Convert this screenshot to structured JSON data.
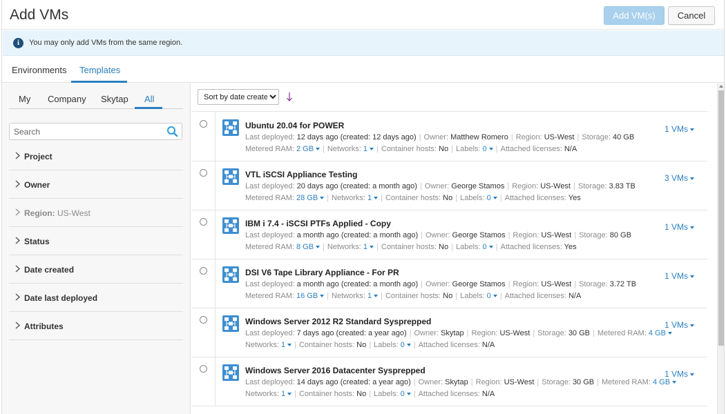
{
  "header": {
    "title": "Add VMs",
    "add_label": "Add VM(s)",
    "cancel_label": "Cancel"
  },
  "info": {
    "text": "You may only add VMs from the same region."
  },
  "tabs": [
    {
      "label": "Environments"
    },
    {
      "label": "Templates",
      "active": true
    }
  ],
  "sidebar": {
    "subtabs": [
      {
        "label": "My"
      },
      {
        "label": "Company"
      },
      {
        "label": "Skytap"
      },
      {
        "label": "All",
        "active": true
      }
    ],
    "search_placeholder": "Search",
    "filters": [
      {
        "label": "Project"
      },
      {
        "label": "Owner"
      },
      {
        "label": "Region:",
        "value": "US-West"
      },
      {
        "label": "Status"
      },
      {
        "label": "Date created"
      },
      {
        "label": "Date last deployed"
      },
      {
        "label": "Attributes"
      }
    ]
  },
  "sort": {
    "selected": "Sort by date created"
  },
  "labels": {
    "last_deployed": "Last deployed:",
    "owner": "Owner:",
    "region": "Region:",
    "storage": "Storage:",
    "metered_ram": "Metered RAM:",
    "networks": "Networks:",
    "container_hosts": "Container hosts:",
    "labels": "Labels:",
    "attached_licenses": "Attached licenses:"
  },
  "templates": [
    {
      "name": "Ubuntu 20.04 for POWER",
      "last_deployed": "12 days ago (created: 12 days ago)",
      "owner": "Matthew Romero",
      "region": "US-West",
      "storage": "40 GB",
      "metered_ram": "2 GB",
      "networks": "1",
      "container_hosts": "No",
      "labels": "0",
      "attached_licenses": "N/A",
      "vms": "1 VMs"
    },
    {
      "name": "VTL iSCSI Appliance Testing",
      "last_deployed": "20 days ago (created: a month ago)",
      "owner": "George Stamos",
      "region": "US-West",
      "storage": "3.83 TB",
      "metered_ram": "28 GB",
      "networks": "1",
      "container_hosts": "No",
      "labels": "0",
      "attached_licenses": "Yes",
      "vms": "3 VMs"
    },
    {
      "name": "IBM i 7.4 - iSCSI PTFs Applied - Copy",
      "last_deployed": "a month ago (created: a month ago)",
      "owner": "George Stamos",
      "region": "US-West",
      "storage": "80 GB",
      "metered_ram": "8 GB",
      "networks": "1",
      "container_hosts": "No",
      "labels": "0",
      "attached_licenses": "Yes",
      "vms": "1 VMs"
    },
    {
      "name": "DSI V6 Tape Library Appliance - For PR",
      "last_deployed": "a month ago (created: a month ago)",
      "owner": "George Stamos",
      "region": "US-West",
      "storage": "3.72 TB",
      "metered_ram": "16 GB",
      "networks": "1",
      "container_hosts": "No",
      "labels": "0",
      "attached_licenses": "N/A",
      "vms": "1 VMs"
    },
    {
      "name": "Windows Server 2012 R2 Standard Sysprepped",
      "last_deployed": "7 days ago (created: a year ago)",
      "owner": "Skytap",
      "region": "US-West",
      "storage": "30 GB",
      "metered_ram": "4 GB",
      "networks": "1",
      "container_hosts": "No",
      "labels": "0",
      "attached_licenses": "N/A",
      "vms": "1 VMs"
    },
    {
      "name": "Windows Server 2016 Datacenter Sysprepped",
      "last_deployed": "14 days ago (created: a year ago)",
      "owner": "Skytap",
      "region": "US-West",
      "storage": "30 GB",
      "metered_ram": "4 GB",
      "networks": "1",
      "container_hosts": "No",
      "labels": "0",
      "attached_licenses": "N/A",
      "vms": "1 VMs"
    }
  ]
}
